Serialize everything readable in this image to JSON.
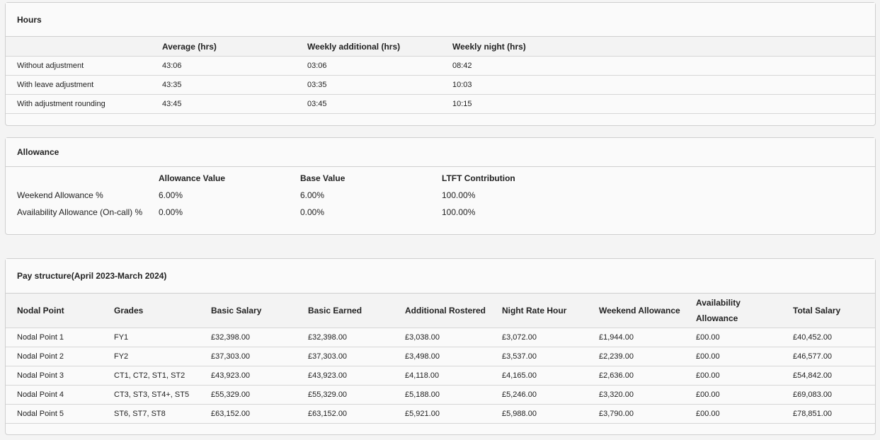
{
  "hours": {
    "title": "Hours",
    "columns": [
      "",
      "Average (hrs)",
      "Weekly additional (hrs)",
      "Weekly night (hrs)"
    ],
    "rows": [
      [
        "Without adjustment",
        "43:06",
        "03:06",
        "08:42"
      ],
      [
        "With leave adjustment",
        "43:35",
        "03:35",
        "10:03"
      ],
      [
        "With adjustment rounding",
        "43:45",
        "03:45",
        "10:15"
      ]
    ]
  },
  "allowance": {
    "title": "Allowance",
    "columns": [
      "",
      "Allowance Value",
      "Base Value",
      "LTFT Contribution"
    ],
    "rows": [
      [
        "Weekend Allowance %",
        "6.00%",
        "6.00%",
        "100.00%"
      ],
      [
        "Availability Allowance (On-call) %",
        "0.00%",
        "0.00%",
        "100.00%"
      ]
    ]
  },
  "pay": {
    "title": "Pay structure(April 2023-March 2024)",
    "columns": [
      "Nodal Point",
      "Grades",
      "Basic Salary",
      "Basic Earned",
      "Additional Rostered",
      "Night Rate Hour",
      "Weekend Allowance",
      "Availability Allowance",
      "Total Salary"
    ],
    "rows": [
      [
        "Nodal Point 1",
        "FY1",
        "£32,398.00",
        "£32,398.00",
        "£3,038.00",
        "£3,072.00",
        "£1,944.00",
        "£00.00",
        "£40,452.00"
      ],
      [
        "Nodal Point 2",
        "FY2",
        "£37,303.00",
        "£37,303.00",
        "£3,498.00",
        "£3,537.00",
        "£2,239.00",
        "£00.00",
        "£46,577.00"
      ],
      [
        "Nodal Point 3",
        "CT1, CT2, ST1, ST2",
        "£43,923.00",
        "£43,923.00",
        "£4,118.00",
        "£4,165.00",
        "£2,636.00",
        "£00.00",
        "£54,842.00"
      ],
      [
        "Nodal Point 4",
        "CT3, ST3, ST4+, ST5",
        "£55,329.00",
        "£55,329.00",
        "£5,188.00",
        "£5,246.00",
        "£3,320.00",
        "£00.00",
        "£69,083.00"
      ],
      [
        "Nodal Point 5",
        "ST6, ST7, ST8",
        "£63,152.00",
        "£63,152.00",
        "£5,921.00",
        "£5,988.00",
        "£3,790.00",
        "£00.00",
        "£78,851.00"
      ]
    ]
  }
}
